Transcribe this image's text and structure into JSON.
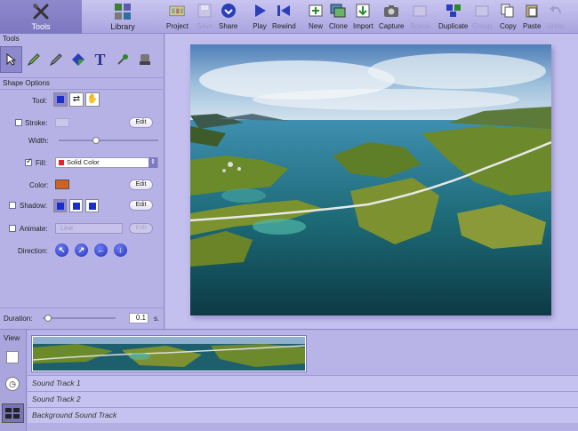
{
  "modes": [
    {
      "label": "Tools",
      "icon": "wrench-screwdriver-icon",
      "active": true
    },
    {
      "label": "Library",
      "icon": "grid-library-icon",
      "active": false
    }
  ],
  "toolbar": [
    {
      "label": "Project",
      "icon": "film-frames-icon",
      "enabled": true
    },
    {
      "label": "Save",
      "icon": "floppy-disk-icon",
      "enabled": false
    },
    {
      "label": "Share",
      "icon": "share-circle-icon",
      "enabled": true
    },
    {
      "label": "Play",
      "icon": "play-icon",
      "enabled": true
    },
    {
      "label": "Rewind",
      "icon": "rewind-icon",
      "enabled": true
    },
    {
      "label": "New",
      "icon": "new-slide-icon",
      "enabled": true
    },
    {
      "label": "Clone",
      "icon": "clone-icon",
      "enabled": true
    },
    {
      "label": "Import",
      "icon": "import-icon",
      "enabled": true
    },
    {
      "label": "Capture",
      "icon": "camera-icon",
      "enabled": true
    },
    {
      "label": "Scene",
      "icon": "scene-icon",
      "enabled": false
    },
    {
      "label": "Duplicate",
      "icon": "duplicate-icon",
      "enabled": true
    },
    {
      "label": "Group",
      "icon": "group-icon",
      "enabled": false
    },
    {
      "label": "Copy",
      "icon": "copy-icon",
      "enabled": true
    },
    {
      "label": "Paste",
      "icon": "paste-icon",
      "enabled": true
    },
    {
      "label": "Undo",
      "icon": "undo-icon",
      "enabled": false
    }
  ],
  "tools_panel": {
    "title": "Tools",
    "tools": [
      "arrow-pointer-icon",
      "pencil-icon",
      "pen-icon",
      "fill-bucket-icon",
      "text-tool-icon",
      "eyedropper-icon",
      "stamp-icon"
    ]
  },
  "shape_options": {
    "title": "Shape Options",
    "tool_label": "Tool:",
    "stroke_label": "Stroke:",
    "stroke_checked": false,
    "edit_label": "Edit",
    "width_label": "Width:",
    "width_value": 0.37,
    "fill_label": "Fill:",
    "fill_checked": true,
    "fill_value": "Solid Color",
    "fill_swatch": "#e0262a",
    "color_label": "Color:",
    "color_value": "#d0611e",
    "shadow_label": "Shadow:",
    "shadow_checked": false,
    "animate_label": "Animate:",
    "animate_checked": false,
    "animate_value": "Line",
    "direction_label": "Direction:",
    "direction_buttons": [
      "↖",
      "↗",
      "←",
      "↓"
    ]
  },
  "duration": {
    "label": "Duration:",
    "value": "0.1",
    "unit": "s.",
    "level": 0.03
  },
  "timeline": {
    "view_label": "View",
    "tracks": [
      "Sound Track 1",
      "Sound Track 2",
      "Background Sound Track"
    ]
  }
}
